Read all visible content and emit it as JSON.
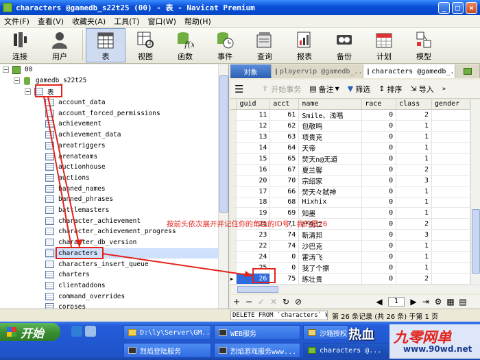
{
  "window": {
    "title": "characters @gamedb_s22t25 (00) - 表 - Navicat Premium"
  },
  "menu": [
    "文件(F)",
    "查看(V)",
    "收藏夹(A)",
    "工具(T)",
    "窗口(W)",
    "帮助(H)"
  ],
  "toolbar": [
    {
      "label": "连接",
      "icon": "connection-icon"
    },
    {
      "label": "用户",
      "icon": "user-icon"
    },
    {
      "label": "表",
      "icon": "table-icon"
    },
    {
      "label": "视图",
      "icon": "view-icon"
    },
    {
      "label": "函数",
      "icon": "function-icon"
    },
    {
      "label": "事件",
      "icon": "event-icon"
    },
    {
      "label": "查询",
      "icon": "query-icon"
    },
    {
      "label": "报表",
      "icon": "report-icon"
    },
    {
      "label": "备份",
      "icon": "backup-icon"
    },
    {
      "label": "计划",
      "icon": "schedule-icon"
    },
    {
      "label": "模型",
      "icon": "model-icon"
    }
  ],
  "tree": {
    "connection": "00",
    "database": "gamedb_s22t25",
    "tables_node": "表",
    "tables": [
      "account_data",
      "account_forced_permissions",
      "achievement",
      "achievement_data",
      "areatriggers",
      "arenateams",
      "auctionhouse",
      "auctions",
      "banned_names",
      "banned_phrases",
      "battlemasters",
      "character_achievement",
      "character_achievement_progress",
      "character_db_version",
      "characters",
      "characters_insert_queue",
      "charters",
      "clientaddons",
      "command_overrides",
      "corpses"
    ],
    "selected": "characters"
  },
  "tabs": [
    {
      "label": "对象"
    },
    {
      "label": "playervip @gamedb_..."
    },
    {
      "label": "characters @gamedb_..."
    }
  ],
  "subtoolbar": {
    "begin_transaction": "开始事务",
    "memo": "备注",
    "filter": "筛选",
    "sort": "排序",
    "import": "导入"
  },
  "grid": {
    "columns": [
      "guid",
      "acct",
      "name",
      "race",
      "class",
      "gender"
    ],
    "rows": [
      [
        "11",
        "61",
        "Smile、浅唱",
        "0",
        "2",
        ""
      ],
      [
        "12",
        "62",
        "包敬鸣",
        "0",
        "1",
        ""
      ],
      [
        "13",
        "63",
        "项贵克",
        "0",
        "1",
        ""
      ],
      [
        "14",
        "64",
        "天帝",
        "0",
        "1",
        ""
      ],
      [
        "15",
        "65",
        "焚天n@无道",
        "0",
        "1",
        ""
      ],
      [
        "16",
        "67",
        "夏兰馨",
        "0",
        "2",
        ""
      ],
      [
        "20",
        "70",
        "宗绍家",
        "0",
        "3",
        ""
      ],
      [
        "17",
        "66",
        "焚天々弑神",
        "0",
        "1",
        ""
      ],
      [
        "18",
        "68",
        "Hixhix",
        "0",
        "1",
        ""
      ],
      [
        "19",
        "69",
        "知墨",
        "0",
        "1",
        ""
      ],
      [
        "21",
        "71",
        "严衡仁",
        "0",
        "2",
        ""
      ],
      [
        "23",
        "74",
        "靳清邦",
        "0",
        "3",
        ""
      ],
      [
        "22",
        "74",
        "沙巴克",
        "0",
        "1",
        ""
      ],
      [
        "24",
        "0",
        "霍涛飞",
        "0",
        "1",
        ""
      ],
      [
        "25",
        "0",
        "我了个擦",
        "0",
        "1",
        ""
      ],
      [
        "26",
        "75",
        "练壮贵",
        "0",
        "2",
        ""
      ]
    ],
    "selected_guid": "26"
  },
  "nav": {
    "page": "1"
  },
  "status": {
    "sql": "DELETE FROM `characters` WHERE",
    "records": "第 26 条记录 (共 26 条) 于第 1 页"
  },
  "annotation": "按前头依次展开并记住你的角色的ID号，我的是26",
  "taskbar": {
    "start": "开始",
    "items": [
      "D:\\ly\\Server\\GM...",
      "WEB服务",
      "沙箱授权",
      "烈焰登陆服务",
      "烈焰游戏服务www...",
      "characters @..."
    ]
  },
  "watermark": {
    "hot": "热血",
    "brand": "九零网单",
    "url": "www.90wd.net"
  },
  "colors": {
    "accent_red": "#e2231a",
    "titlebar_blue": "#0a4fd6",
    "selection": "#cfe0fb"
  }
}
